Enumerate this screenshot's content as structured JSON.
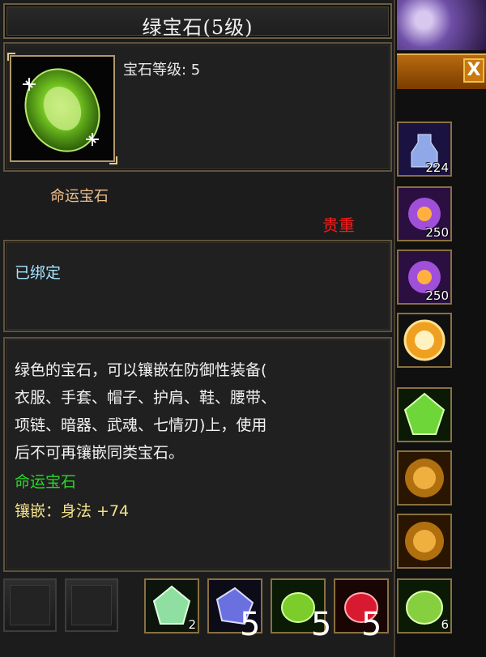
{
  "tooltip": {
    "title": "绿宝石(5级)",
    "stat_line": "宝石等级: 5",
    "type_line": "命运宝石",
    "rarity": "贵重",
    "bound": "已绑定",
    "description": [
      "绿色的宝石，可以镶嵌在防御性装备(",
      "衣服、手套、帽子、护肩、鞋、腰带、",
      "项链、暗器、武魂、七情刃)上，使用",
      "后不可再镶嵌同类宝石。"
    ],
    "set_line": "命运宝石",
    "attribute_line": "镶嵌：身法  +74"
  },
  "close": "X",
  "right_items": [
    {
      "icon": "bottle-icon",
      "count": "224"
    },
    {
      "icon": "purple-orb-icon",
      "count": "250"
    },
    {
      "icon": "purple-orb-icon",
      "count": "250"
    },
    {
      "icon": "orange-token-icon",
      "count": ""
    },
    {
      "icon": "green-gem-icon",
      "count": ""
    },
    {
      "icon": "gold-orb-icon",
      "count": ""
    },
    {
      "icon": "gold-orb-icon",
      "count": ""
    }
  ],
  "bottom_items": [
    {
      "icon": "light-green-gem-icon",
      "count": "2"
    },
    {
      "icon": "blue-gem-icon",
      "count": ""
    },
    {
      "icon": "green-gem-icon",
      "count": ""
    },
    {
      "icon": "red-gem-icon",
      "count": ""
    },
    {
      "icon": "green-gem-icon",
      "count": "6"
    }
  ],
  "overlay_numbers": [
    "5",
    "5",
    "5"
  ],
  "colors": {
    "rarity": "#ff1a1a",
    "bound": "#a6e4ff",
    "set": "#2bd62b",
    "attribute": "#f3e089",
    "type": "#f0c090"
  }
}
